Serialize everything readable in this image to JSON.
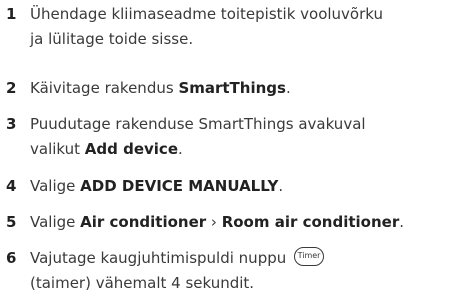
{
  "steps": [
    {
      "number": "1",
      "lines": [
        "Ühendage kliimaseadme toitepistik vooluvõrku",
        "ja lülitage toide sisse."
      ]
    },
    {
      "number": "2",
      "prefix": "Käivitage rakendus ",
      "bold": "SmartThings",
      "suffix": "."
    },
    {
      "number": "3",
      "line1": "Puudutage rakenduse SmartThings avakuval",
      "line2_prefix": "valikut ",
      "line2_bold": "Add device",
      "line2_suffix": "."
    },
    {
      "number": "4",
      "prefix": "Valige ",
      "bold": "ADD DEVICE MANUALLY",
      "suffix": "."
    },
    {
      "number": "5",
      "prefix": "Valige ",
      "bold1": "Air conditioner",
      "separator": " › ",
      "bold2": "Room air conditioner",
      "suffix": "."
    },
    {
      "number": "6",
      "line1_prefix": "Vajutage kaugjuhtimispuldi nuppu ",
      "button_label": "Timer",
      "line2": "(taimer) vähemalt 4 sekundit."
    }
  ]
}
